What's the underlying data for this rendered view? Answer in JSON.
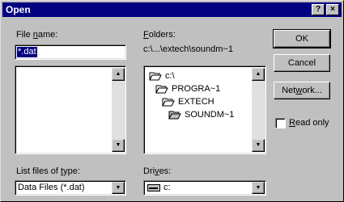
{
  "window": {
    "title": "Open",
    "help_button": "?",
    "close_button": "×"
  },
  "file_name": {
    "label": "File name:",
    "label_pre": "File ",
    "label_ul": "n",
    "label_post": "ame:",
    "value": "*.dat"
  },
  "folders": {
    "label_pre": "",
    "label_ul": "F",
    "label_post": "olders:",
    "path": "c:\\...\\extech\\soundm~1",
    "items": [
      {
        "name": "c:\\",
        "icon": "open-folder-icon",
        "level": 0
      },
      {
        "name": "PROGRA~1",
        "icon": "open-folder-icon",
        "level": 1
      },
      {
        "name": "EXTECH",
        "icon": "open-folder-icon",
        "level": 2
      },
      {
        "name": "SOUNDM~1",
        "icon": "open-folder-icon",
        "level": 3
      }
    ]
  },
  "buttons": {
    "ok": "OK",
    "cancel": "Cancel",
    "network_pre": "Net",
    "network_ul": "w",
    "network_post": "ork..."
  },
  "read_only": {
    "label_ul": "R",
    "label_post": "ead only",
    "checked": false
  },
  "file_type": {
    "label_pre": "List files of ",
    "label_ul": "t",
    "label_post": "ype:",
    "value": "Data Files (*.dat)"
  },
  "drives": {
    "label_pre": "Dri",
    "label_ul": "v",
    "label_post": "es:",
    "value": "c:",
    "icon": "drive-icon"
  }
}
